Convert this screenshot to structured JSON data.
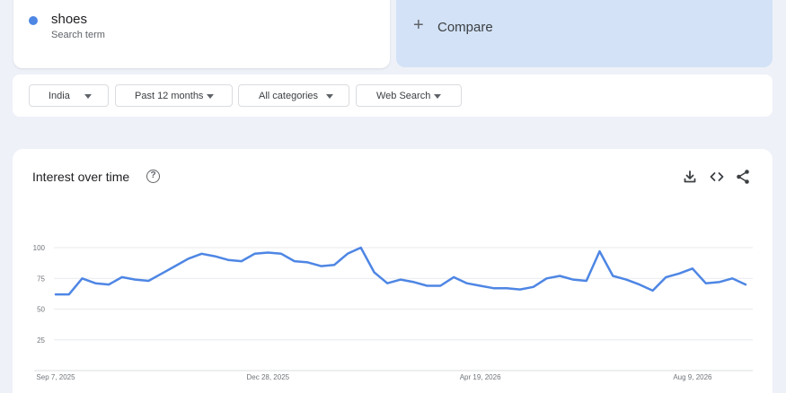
{
  "search_term": {
    "name": "shoes",
    "subtitle": "Search term",
    "dot_color": "#4e86e4"
  },
  "compare": {
    "plus": "+",
    "label": "Compare"
  },
  "filters": [
    {
      "label": "India"
    },
    {
      "label": "Past 12 months"
    },
    {
      "label": "All categories"
    },
    {
      "label": "Web Search"
    }
  ],
  "chart_card": {
    "title": "Interest over time",
    "help_icon": "?",
    "icons": [
      "download-icon",
      "embed-icon",
      "share-icon"
    ]
  },
  "chart_data": {
    "type": "line",
    "title": "Interest over time",
    "xlabel": "",
    "ylabel": "",
    "ylim": [
      0,
      100
    ],
    "yticks": [
      25,
      50,
      75,
      100
    ],
    "x_tick_labels": [
      {
        "label": "Sep 7, 2025",
        "index": 0
      },
      {
        "label": "Dec 28, 2025",
        "index": 16
      },
      {
        "label": "Apr 19, 2026",
        "index": 32
      },
      {
        "label": "Aug 9, 2026",
        "index": 48
      }
    ],
    "grid": true,
    "series": [
      {
        "color": "#4e86e4",
        "values": [
          62,
          62,
          75,
          71,
          70,
          76,
          74,
          73,
          79,
          85,
          91,
          95,
          93,
          90,
          89,
          95,
          96,
          95,
          89,
          88,
          85,
          86,
          95,
          100,
          80,
          71,
          74,
          72,
          69,
          69,
          76,
          71,
          69,
          67,
          67,
          66,
          68,
          75,
          77,
          74,
          73,
          97,
          77,
          74,
          70,
          65,
          76,
          79,
          83,
          71,
          72,
          75,
          70
        ]
      }
    ]
  }
}
